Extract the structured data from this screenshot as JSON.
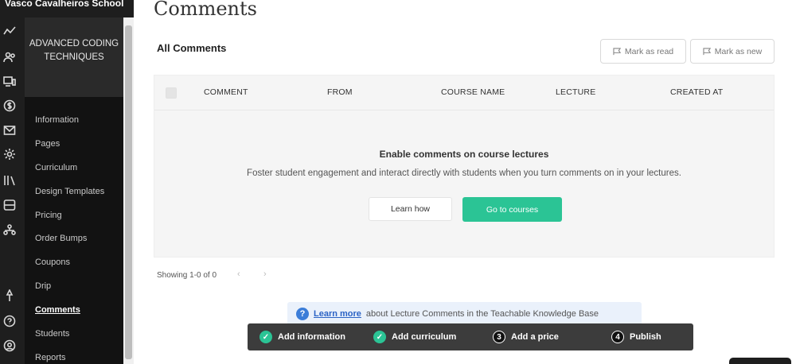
{
  "school": {
    "name": "Vasco Cavalheiros School"
  },
  "rail_icons": [
    "trend-icon",
    "users-icon",
    "devices-icon",
    "dollar-icon",
    "mail-icon",
    "gear-icon",
    "library-icon",
    "storage-icon",
    "org-icon",
    "pin-icon",
    "help-icon",
    "account-icon"
  ],
  "course": {
    "title": "ADVANCED CODING TECHNIQUES",
    "nav": [
      {
        "label": "Information"
      },
      {
        "label": "Pages"
      },
      {
        "label": "Curriculum"
      },
      {
        "label": "Design Templates"
      },
      {
        "label": "Pricing"
      },
      {
        "label": "Order Bumps"
      },
      {
        "label": "Coupons"
      },
      {
        "label": "Drip"
      },
      {
        "label": "Comments",
        "active": true
      },
      {
        "label": "Students"
      },
      {
        "label": "Reports"
      }
    ]
  },
  "page": {
    "title": "Comments",
    "section_title": "All Comments",
    "mark_read": "Mark as read",
    "mark_new": "Mark as new"
  },
  "table": {
    "columns": [
      "COMMENT",
      "FROM",
      "COURSE NAME",
      "LECTURE",
      "CREATED AT"
    ],
    "empty_title": "Enable comments on course lectures",
    "empty_text": "Foster student engagement and interact directly with students when you turn comments on in your lectures.",
    "learn_how": "Learn how",
    "go_to_courses": "Go to courses"
  },
  "pagination": {
    "showing": "Showing 1-0 of 0",
    "prev": "‹",
    "next": "›"
  },
  "kb": {
    "link": "Learn more",
    "text": "about Lecture Comments in the Teachable Knowledge Base"
  },
  "steps": [
    {
      "label": "Add information",
      "state": "done",
      "marker": "✓"
    },
    {
      "label": "Add curriculum",
      "state": "done",
      "marker": "✓"
    },
    {
      "label": "Add a price",
      "state": "todo",
      "marker": "3"
    },
    {
      "label": "Publish",
      "state": "todo",
      "marker": "4"
    }
  ],
  "colors": {
    "accent": "#2bc495",
    "sidebar_dark": "#121212",
    "link": "#2b63c5"
  }
}
